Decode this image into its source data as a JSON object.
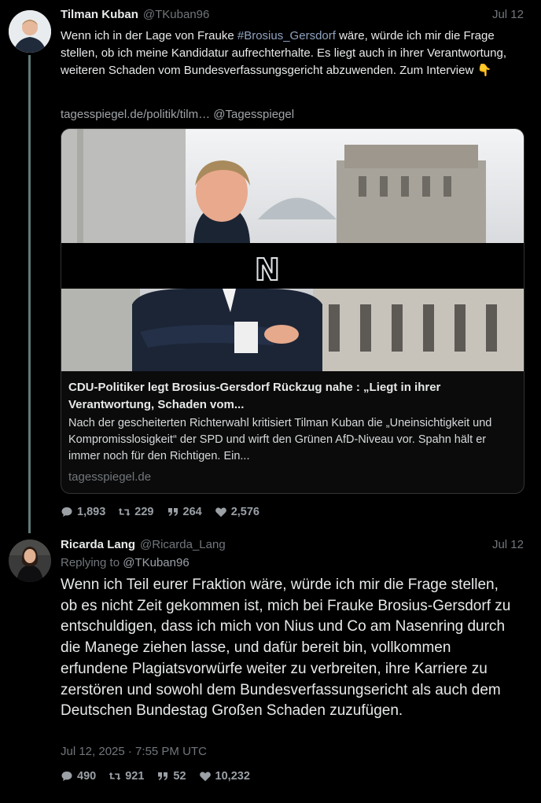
{
  "tweet1": {
    "author_name": "Tilman Kuban",
    "author_handle": "@TKuban96",
    "date": "Jul 12",
    "text_pre": "Wenn ich in der Lage von Frauke ",
    "hashtag": "#Brosius_Gersdorf",
    "text_post": " wäre, würde ich mir die Frage stellen, ob ich meine Kandidatur aufrechterhalte. Es liegt auch in ihrer Verantwortung, weiteren Schaden vom Bundesverfassungsgericht abzuwenden. Zum Interview 👇",
    "link_url": "tagesspiegel.de/politik/tilm…",
    "link_mention": "@Tagesspiegel",
    "card": {
      "logo": "N",
      "title": "CDU-Politiker legt Brosius-Gersdorf Rückzug nahe : „Liegt in ihrer Verantwortung, Schaden vom...",
      "description": "Nach der gescheiterten Richterwahl kritisiert Tilman Kuban die „Uneinsichtigkeit und Kompromisslosigkeit“ der SPD und wirft den Grünen AfD-Niveau vor. Spahn hält er immer noch für den Richtigen. Ein...",
      "domain": "tagesspiegel.de"
    },
    "stats": {
      "replies": "1,893",
      "retweets": "229",
      "quotes": "264",
      "likes": "2,576"
    }
  },
  "tweet2": {
    "author_name": "Ricarda Lang",
    "author_handle": "@Ricarda_Lang",
    "date": "Jul 12",
    "replying_label": "Replying to",
    "replying_to": "@TKuban96",
    "text": "Wenn ich Teil eurer Fraktion wäre, würde ich mir die Frage stellen, ob es nicht Zeit gekommen ist, mich bei Frauke Brosius-Gersdorf zu entschuldigen, dass ich mich von Nius und Co am Nasenring durch die Manege ziehen lasse, und dafür bereit bin, vollkommen erfundene Plagiatsvorwürfe weiter zu verbreiten, ihre Karriere zu zerstören und sowohl dem Bundesverfassungsericht als auch dem Deutschen Bundestag Großen Schaden zuzufügen.",
    "timestamp": "Jul 12, 2025 · 7:55 PM UTC",
    "stats": {
      "replies": "490",
      "retweets": "921",
      "quotes": "52",
      "likes": "10,232"
    }
  },
  "icons": [
    "comment-icon",
    "retweet-icon",
    "quote-icon",
    "heart-icon"
  ],
  "colors": {
    "background": "#000000",
    "text": "#e7e9ea",
    "muted": "#71767b",
    "hashtag": "#8fa3bf",
    "thread_line": "#5f7a75"
  }
}
